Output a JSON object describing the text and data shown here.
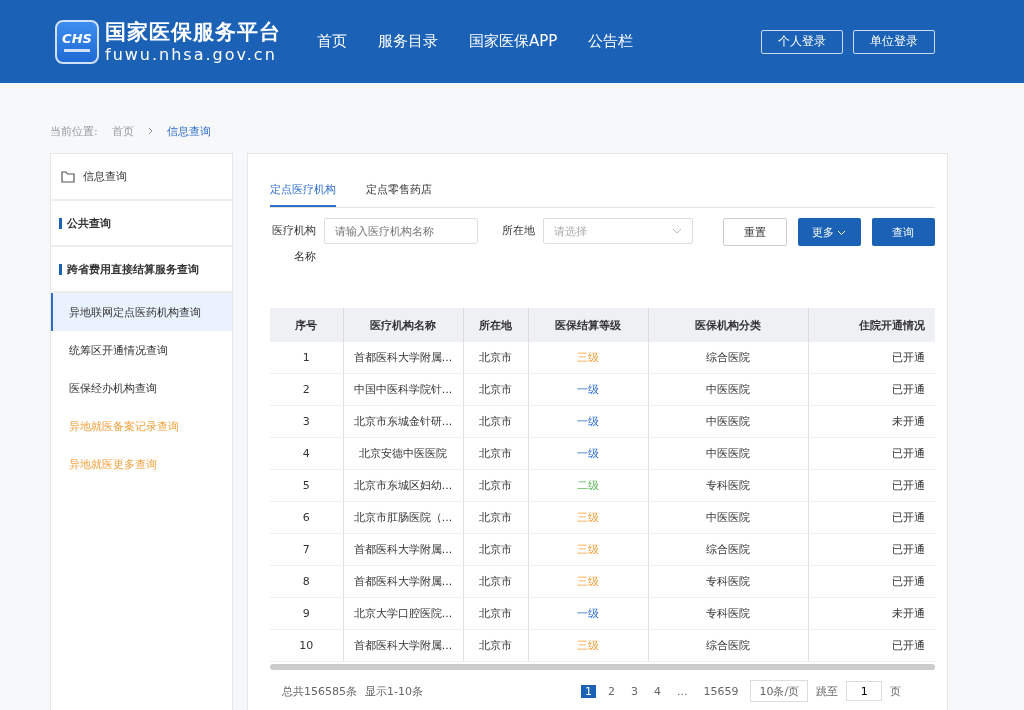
{
  "header": {
    "logo_mark": "CHS",
    "site_title": "国家医保服务平台",
    "site_url": "fuwu.nhsa.gov.cn",
    "nav": [
      {
        "label": "首页"
      },
      {
        "label": "服务目录"
      },
      {
        "label": "国家医保APP"
      },
      {
        "label": "公告栏"
      }
    ],
    "login_buttons": [
      "个人登录",
      "单位登录"
    ]
  },
  "breadcrumb": {
    "prefix": "当前位置:",
    "items": [
      {
        "label": "首页",
        "selected": false
      },
      {
        "label": "信息查询",
        "selected": true
      }
    ]
  },
  "sidebar": {
    "title": "信息查询",
    "sections": [
      {
        "label": "公共查询"
      },
      {
        "label": "跨省费用直接结算服务查询",
        "items": [
          {
            "label": "异地联网定点医药机构查询",
            "selected": true,
            "kind": "plain"
          },
          {
            "label": "统筹区开通情况查询",
            "selected": false,
            "kind": "plain"
          },
          {
            "label": "医保经办机构查询",
            "selected": false,
            "kind": "plain"
          },
          {
            "label": "异地就医备案记录查询",
            "selected": false,
            "kind": "highlight"
          },
          {
            "label": "异地就医更多查询",
            "selected": false,
            "kind": "highlight"
          }
        ]
      }
    ]
  },
  "tabs": [
    {
      "label": "定点医疗机构",
      "selected": true
    },
    {
      "label": "定点零售药店",
      "selected": false
    }
  ],
  "filters": {
    "name_label": "医疗机构名称",
    "name_placeholder": "请输入医疗机构名称",
    "location_label": "所在地",
    "location_placeholder": "请选择",
    "reset": "重置",
    "more": "更多",
    "search": "查询"
  },
  "table": {
    "columns": [
      "序号",
      "医疗机构名称",
      "所在地",
      "医保结算等级",
      "医保机构分类",
      "住院开通情况"
    ],
    "rows": [
      {
        "no": "1",
        "name": "首都医科大学附属...",
        "location": "北京市",
        "grade": "三级",
        "kind": "tertiary",
        "category": "综合医院",
        "inpatient": "已开通"
      },
      {
        "no": "2",
        "name": "中国中医科学院针...",
        "location": "北京市",
        "grade": "一级",
        "kind": "primary",
        "category": "中医医院",
        "inpatient": "已开通"
      },
      {
        "no": "3",
        "name": "北京市东城金针研...",
        "location": "北京市",
        "grade": "一级",
        "kind": "primary",
        "category": "中医医院",
        "inpatient": "未开通"
      },
      {
        "no": "4",
        "name": "北京安德中医医院",
        "location": "北京市",
        "grade": "一级",
        "kind": "primary",
        "category": "中医医院",
        "inpatient": "已开通"
      },
      {
        "no": "5",
        "name": "北京市东城区妇幼...",
        "location": "北京市",
        "grade": "二级",
        "kind": "secondary",
        "category": "专科医院",
        "inpatient": "已开通"
      },
      {
        "no": "6",
        "name": "北京市肛肠医院（...",
        "location": "北京市",
        "grade": "三级",
        "kind": "tertiary",
        "category": "中医医院",
        "inpatient": "已开通"
      },
      {
        "no": "7",
        "name": "首都医科大学附属...",
        "location": "北京市",
        "grade": "三级",
        "kind": "tertiary",
        "category": "综合医院",
        "inpatient": "已开通"
      },
      {
        "no": "8",
        "name": "首都医科大学附属...",
        "location": "北京市",
        "grade": "三级",
        "kind": "tertiary",
        "category": "专科医院",
        "inpatient": "已开通"
      },
      {
        "no": "9",
        "name": "北京大学口腔医院...",
        "location": "北京市",
        "grade": "一级",
        "kind": "primary",
        "category": "专科医院",
        "inpatient": "未开通"
      },
      {
        "no": "10",
        "name": "首都医科大学附属...",
        "location": "北京市",
        "grade": "三级",
        "kind": "tertiary",
        "category": "综合医院",
        "inpatient": "已开通"
      }
    ]
  },
  "pagination": {
    "total": "总共156585条",
    "range": "显示1-10条",
    "pages": [
      {
        "label": "1",
        "selected": true
      },
      {
        "label": "2",
        "selected": false
      },
      {
        "label": "3",
        "selected": false
      },
      {
        "label": "4",
        "selected": false
      },
      {
        "label": "...",
        "selected": false
      },
      {
        "label": "15659",
        "selected": false
      }
    ],
    "page_size": "10条/页",
    "jump_label": "跳至",
    "jump_value": "1",
    "page_suffix": "页"
  }
}
